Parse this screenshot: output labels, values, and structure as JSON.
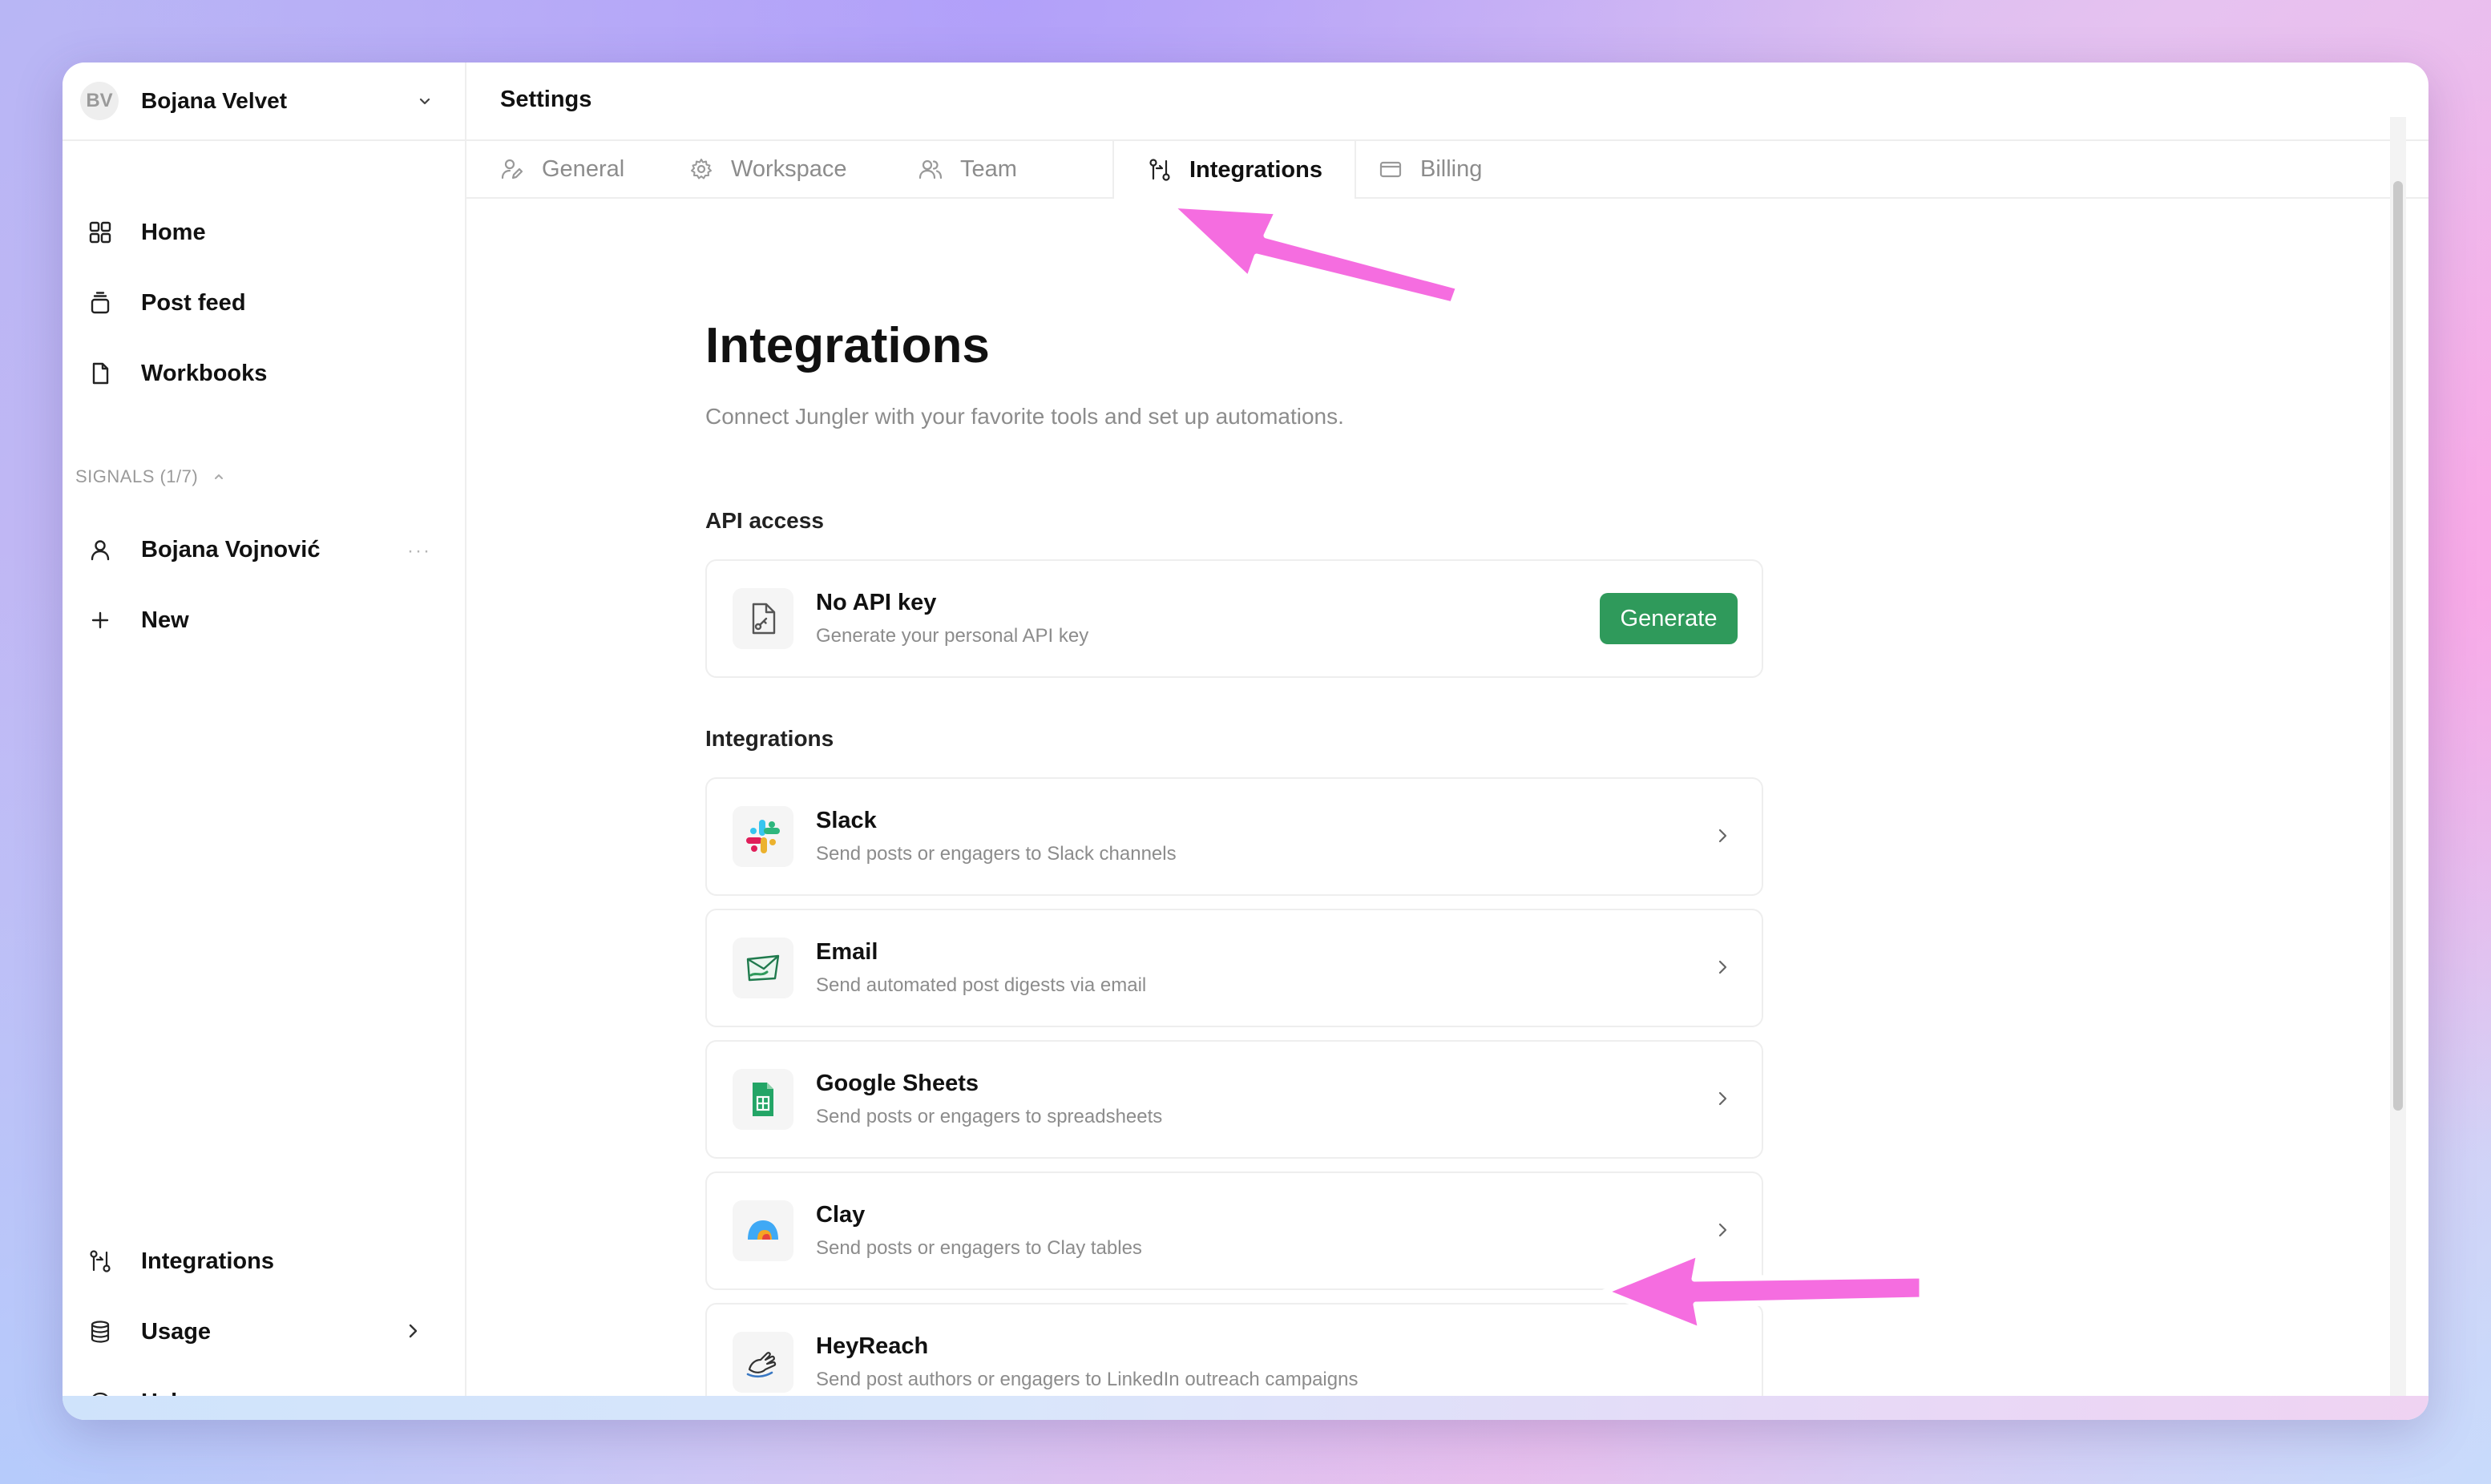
{
  "workspace": {
    "initials": "BV",
    "name": "Bojana Velvet"
  },
  "sidebar": {
    "nav": [
      {
        "label": "Home",
        "icon": "grid-icon"
      },
      {
        "label": "Post feed",
        "icon": "stack-icon"
      },
      {
        "label": "Workbooks",
        "icon": "file-icon"
      }
    ],
    "signals_label": "SIGNALS (1/7)",
    "signals": [
      {
        "label": "Bojana Vojnović",
        "icon": "user-icon"
      }
    ],
    "new_label": "New",
    "bottom": [
      {
        "label": "Integrations",
        "icon": "integrations-icon"
      },
      {
        "label": "Usage",
        "icon": "database-icon"
      },
      {
        "label": "Help",
        "icon": "chat-bubble-icon"
      }
    ]
  },
  "header": {
    "title": "Settings"
  },
  "tabs": [
    {
      "label": "General",
      "icon": "user-pen-icon"
    },
    {
      "label": "Workspace",
      "icon": "gear-icon"
    },
    {
      "label": "Team",
      "icon": "users-icon"
    },
    {
      "label": "Integrations",
      "icon": "integrations-icon",
      "active": true
    },
    {
      "label": "Billing",
      "icon": "credit-card-icon"
    }
  ],
  "page": {
    "title": "Integrations",
    "subtitle": "Connect Jungler with your favorite tools and set up automations.",
    "api_section": "API access",
    "api": {
      "title": "No API key",
      "desc": "Generate your personal API key",
      "button": "Generate"
    },
    "integrations_section": "Integrations",
    "integrations": [
      {
        "name": "Slack",
        "desc": "Send posts or engagers to Slack channels",
        "icon": "slack-icon"
      },
      {
        "name": "Email",
        "desc": "Send automated post digests via email",
        "icon": "email-icon"
      },
      {
        "name": "Google Sheets",
        "desc": "Send posts or engagers to spreadsheets",
        "icon": "google-sheets-icon"
      },
      {
        "name": "Clay",
        "desc": "Send posts or engagers to Clay tables",
        "icon": "clay-icon"
      },
      {
        "name": "HeyReach",
        "desc": "Send post authors or engagers to LinkedIn outreach campaigns",
        "icon": "heyreach-icon"
      }
    ]
  },
  "colors": {
    "accent_green": "#2f9a5b",
    "annotation_arrow": "#f56de0"
  }
}
